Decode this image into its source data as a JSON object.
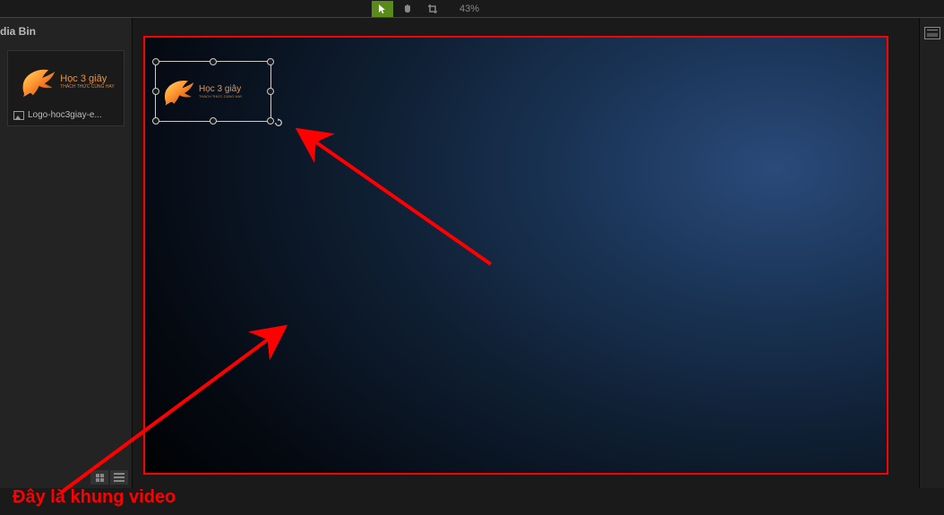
{
  "toolbar": {
    "zoom": "43%"
  },
  "sidebar": {
    "title": "dia Bin",
    "media_item": {
      "logo_text_main": "Học 3 giây",
      "logo_text_sub": "THÁCH THỨC CÙNG HAY",
      "filename": "Logo-hoc3giay-e..."
    }
  },
  "canvas": {
    "selected_logo_main": "Học 3 giây",
    "selected_logo_sub": "THÁCH THỨC CÙNG HAY"
  },
  "annotation": {
    "label": "Đây là khung video"
  }
}
